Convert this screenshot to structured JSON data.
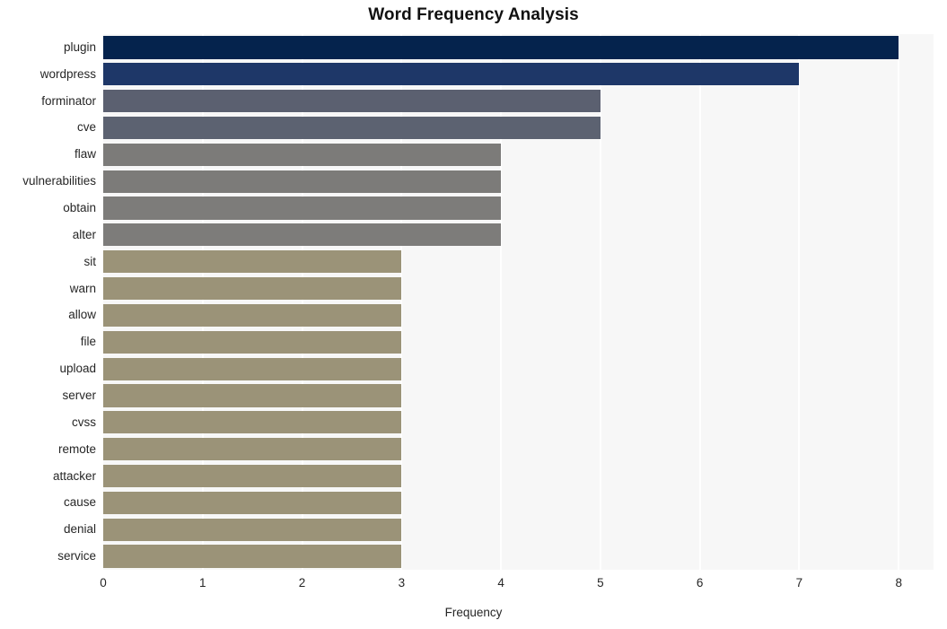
{
  "chart_data": {
    "type": "bar",
    "orientation": "horizontal",
    "title": "Word Frequency Analysis",
    "xlabel": "Frequency",
    "ylabel": "",
    "categories": [
      "plugin",
      "wordpress",
      "forminator",
      "cve",
      "flaw",
      "vulnerabilities",
      "obtain",
      "alter",
      "sit",
      "warn",
      "allow",
      "file",
      "upload",
      "server",
      "cvss",
      "remote",
      "attacker",
      "cause",
      "denial",
      "service"
    ],
    "values": [
      8,
      7,
      5,
      5,
      4,
      4,
      4,
      4,
      3,
      3,
      3,
      3,
      3,
      3,
      3,
      3,
      3,
      3,
      3,
      3
    ],
    "bar_colors": [
      "#05234d",
      "#1e3768",
      "#5b6070",
      "#5c6271",
      "#7c7b79",
      "#7c7b79",
      "#7d7c7a",
      "#7d7c7a",
      "#9b9378",
      "#9b9378",
      "#9b9378",
      "#9b9378",
      "#9b9378",
      "#9b9378",
      "#9b9378",
      "#9b9378",
      "#9b9378",
      "#9b9378",
      "#9b9378",
      "#9b9378"
    ],
    "xlim": [
      0,
      8.35
    ],
    "xticks": [
      0,
      1,
      2,
      3,
      4,
      5,
      6,
      7,
      8
    ],
    "xtick_labels": [
      "0",
      "1",
      "2",
      "3",
      "4",
      "5",
      "6",
      "7",
      "8"
    ],
    "grid": true,
    "grid_axis": "x",
    "grid_color": "#ffffff",
    "legend": false,
    "plot_background": "#f7f7f7",
    "figure_background": "#ffffff"
  }
}
